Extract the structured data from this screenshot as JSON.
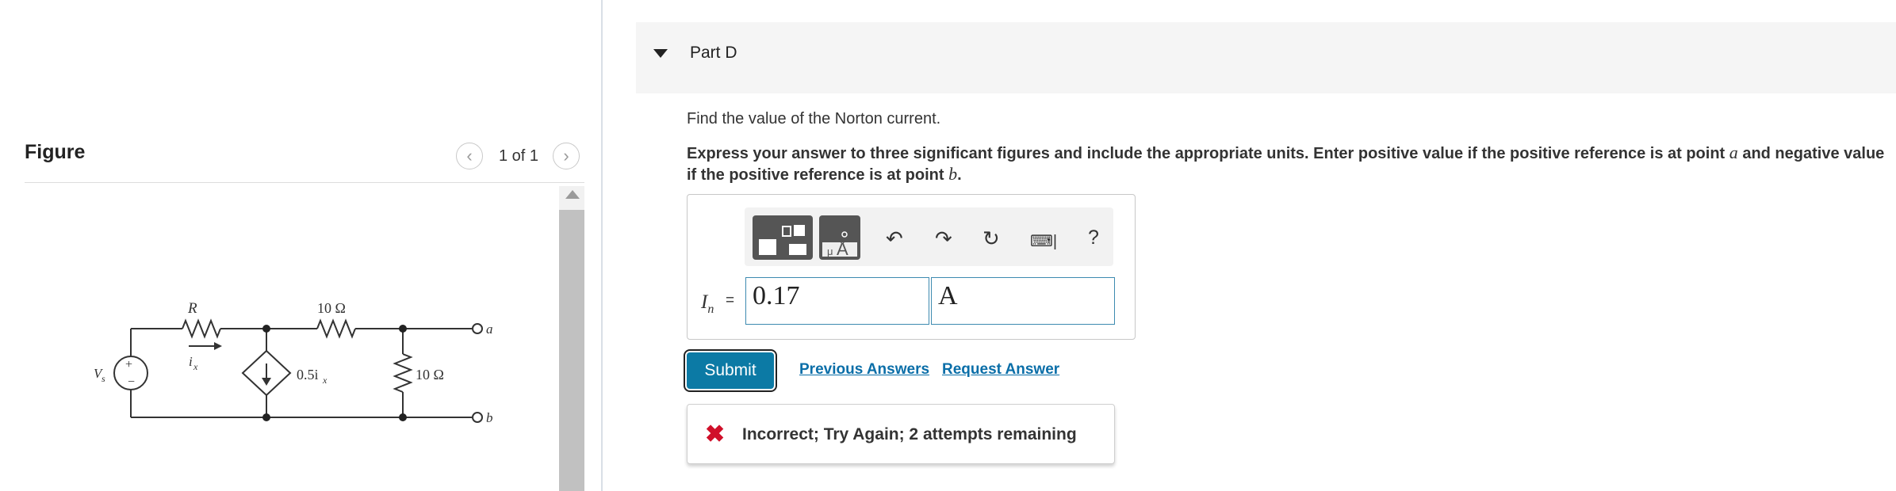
{
  "figure_panel": {
    "title": "Figure",
    "pager": "1 of 1",
    "prev_icon": "chevron-left-icon",
    "next_icon": "chevron-right-icon",
    "circuit": {
      "source_label": "V",
      "source_sub": "s",
      "resistor_R": "R",
      "current_label": "i",
      "current_sub": "x",
      "resistor_10a": "10 Ω",
      "dependent_source": "0.5i",
      "dependent_sub": "x",
      "resistor_10b": "10 Ω",
      "terminal_a": "a",
      "terminal_b": "b"
    }
  },
  "part": {
    "title": "Part D",
    "question": "Find the value of the Norton current.",
    "instructions_1": "Express your answer to three significant figures and include the appropriate units. Enter positive value if the positive reference is at point ",
    "point_a": "a",
    "instructions_2": " and negative value if the positive reference is at point ",
    "point_b": "b",
    "instructions_3": "."
  },
  "answer": {
    "label_var": "I",
    "label_sub": "n",
    "label_eq": "=",
    "value": "0.17",
    "unit": "A",
    "toolbar_icons": [
      "templates-icon",
      "units-icon",
      "undo-icon",
      "redo-icon",
      "reset-icon",
      "keyboard-icon",
      "help-icon"
    ],
    "help": "?"
  },
  "actions": {
    "submit": "Submit",
    "previous_answers": "Previous Answers",
    "request_answer": "Request Answer"
  },
  "feedback": {
    "icon": "x-icon",
    "text": "Incorrect; Try Again; 2 attempts remaining",
    "color": "#d0102a"
  },
  "colors": {
    "submit_bg": "#0c7aa5",
    "link": "#0a6ea8",
    "input_border": "#3d8ab0"
  }
}
